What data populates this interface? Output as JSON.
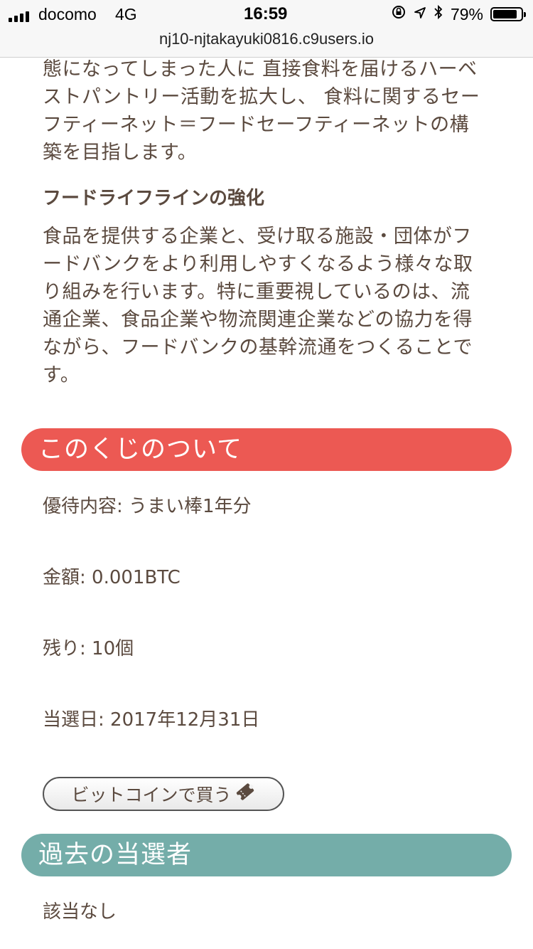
{
  "status_bar": {
    "carrier": "docomo",
    "network": "4G",
    "time": "16:59",
    "battery_percent": "79%",
    "battery_level": 0.79,
    "icons": [
      "signal-icon",
      "orientation-lock-icon",
      "location-icon",
      "bluetooth-icon",
      "battery-icon"
    ]
  },
  "browser": {
    "url": "nj10-njtakayuki0816.c9users.io"
  },
  "intro": {
    "lines": [
      "態になってしまった人に 直接食料を届けるハーベ",
      "ストパントリー活動を拡大し、 食料に関するセー",
      "フティーネット＝フードセーフティーネットの構",
      "築を目指します。"
    ]
  },
  "lifeline": {
    "heading": "フードライフラインの強化",
    "lines": [
      "食品を提供する企業と、受け取る施設・団体がフ",
      "ードバンクをより利用しやすくなるよう様々な取",
      "り組みを行います。特に重要視しているのは、流",
      "通企業、食品企業や物流関連企業などの協力を得",
      "ながら、フードバンクの基幹流通をつくることで",
      "す。"
    ]
  },
  "lottery": {
    "header": "このくじのついて",
    "header_color": "#ec5953",
    "benefit": "優待内容: うまい棒1年分",
    "price": "金額: 0.001BTC",
    "remaining": "残り: 10個",
    "draw_date": "当選日: 2017年12月31日",
    "buy_label": "ビットコインで買う",
    "buy_icon": "ticket-icon"
  },
  "winners": {
    "header": "過去の当選者",
    "header_color": "#74ada9",
    "value": "該当なし"
  }
}
